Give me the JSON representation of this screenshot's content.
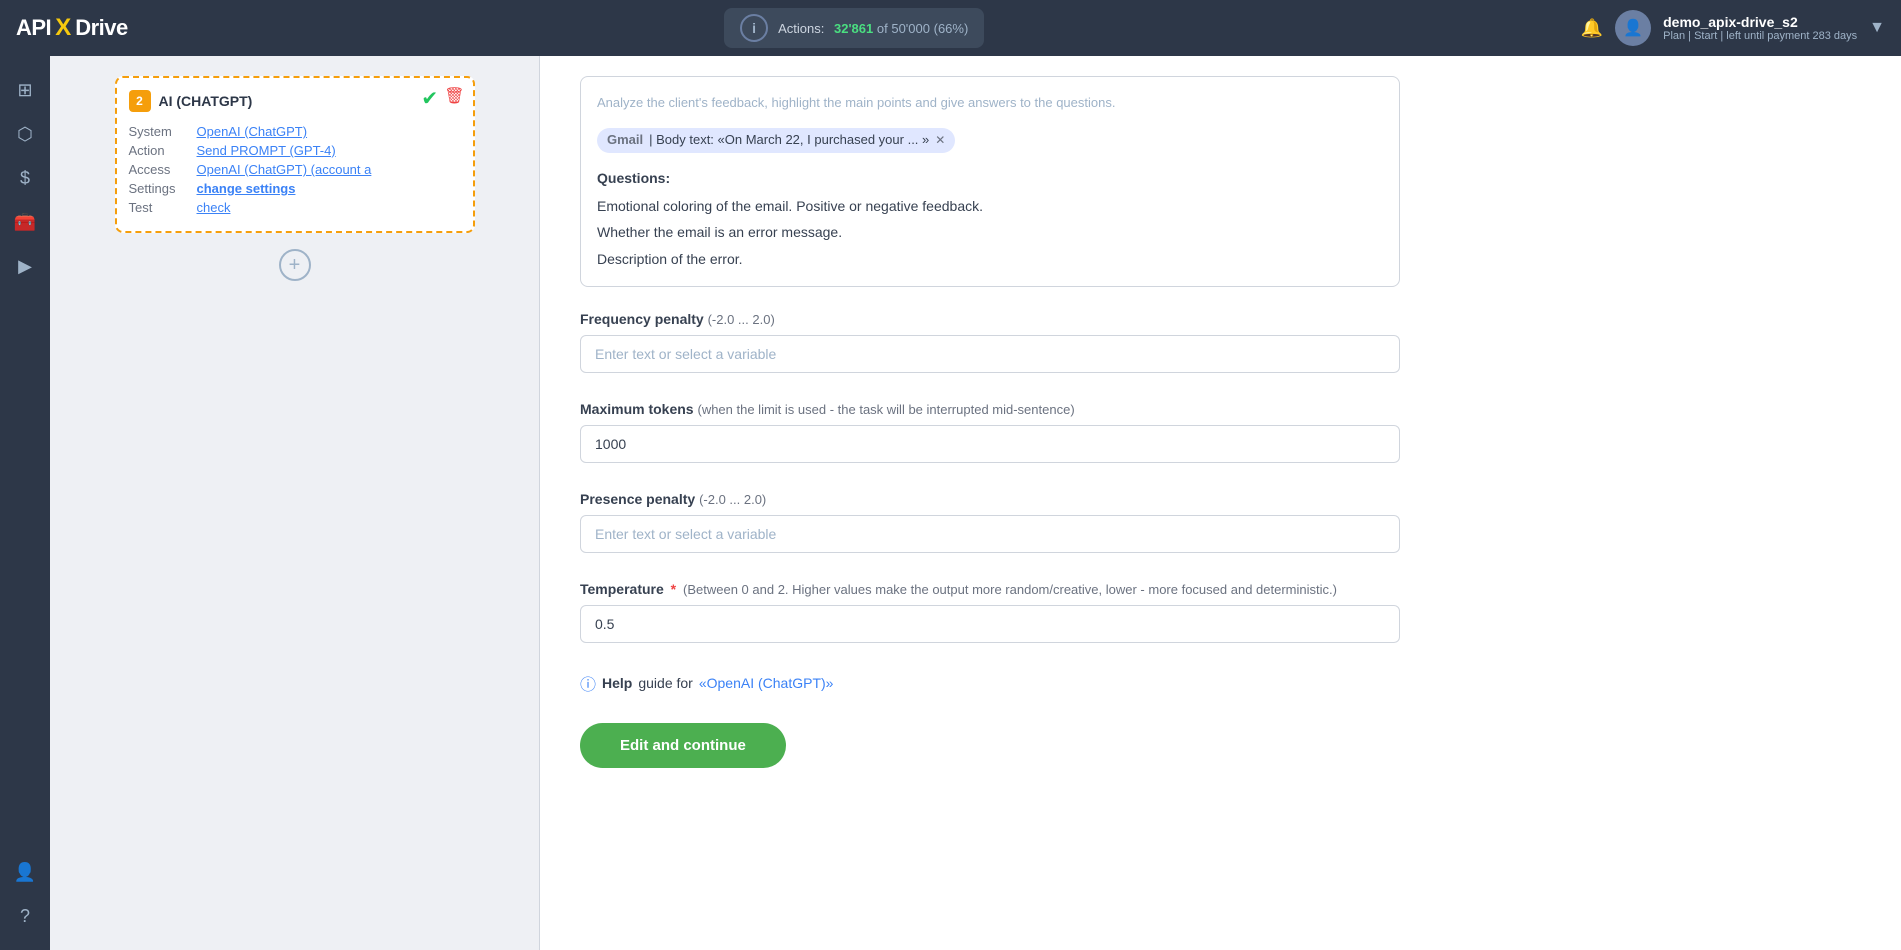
{
  "topnav": {
    "logo": "APIXDrive",
    "logo_x": "X",
    "actions_label": "Actions:",
    "actions_count": "32'861",
    "actions_of": "of",
    "actions_total": "50'000",
    "actions_pct": "(66%)",
    "bell_icon": "🔔",
    "avatar_icon": "👤",
    "user_name": "demo_apix-drive_s2",
    "user_plan": "Plan | Start | left until payment 283 days",
    "chevron": "▼"
  },
  "sidebar": {
    "items": [
      {
        "icon": "⊞",
        "name": "dashboard"
      },
      {
        "icon": "⬡",
        "name": "connections"
      },
      {
        "icon": "$",
        "name": "billing"
      },
      {
        "icon": "🧰",
        "name": "tools"
      },
      {
        "icon": "▶",
        "name": "runs"
      },
      {
        "icon": "👤",
        "name": "profile"
      },
      {
        "icon": "?",
        "name": "help"
      }
    ]
  },
  "ai_card": {
    "badge": "2",
    "title": "AI (CHATGPT)",
    "rows": [
      {
        "label": "System",
        "value": "OpenAI (ChatGPT)",
        "type": "link"
      },
      {
        "label": "Action",
        "value": "Send PROMPT (GPT-4)",
        "type": "link"
      },
      {
        "label": "Access",
        "value": "OpenAI (ChatGPT) (account a",
        "type": "link"
      },
      {
        "label": "Settings",
        "value": "change settings",
        "type": "bold-link"
      },
      {
        "label": "Test",
        "value": "check",
        "type": "link"
      }
    ]
  },
  "prompt_box": {
    "intro": "Analyze the client's feedback, highlight the main points and give answers to the questions.",
    "tag_source": "Gmail",
    "tag_text": "| Body text: «On March 22, I purchased your ... »",
    "questions_label": "Questions:",
    "question1": "Emotional coloring of the email.  Positive or negative feedback.",
    "question2": "Whether the email is an error message.",
    "question3": "Description of the error."
  },
  "form": {
    "frequency_label": "Frequency penalty",
    "frequency_note": "(-2.0 ... 2.0)",
    "frequency_placeholder": "Enter text or select a variable",
    "frequency_value": "",
    "max_tokens_label": "Maximum tokens",
    "max_tokens_note": "(when the limit is used - the task will be interrupted mid-sentence)",
    "max_tokens_value": "1000",
    "presence_label": "Presence penalty",
    "presence_note": "(-2.0 ... 2.0)",
    "presence_placeholder": "Enter text or select a variable",
    "presence_value": "",
    "temperature_label": "Temperature",
    "temperature_required": "*",
    "temperature_note": "(Between 0 and 2. Higher values make the output more random/creative, lower - more focused and deterministic.)",
    "temperature_value": "0.5",
    "help_text": "Help",
    "help_guide": "guide for",
    "help_link": "«OpenAI (ChatGPT)»",
    "edit_btn": "Edit and continue"
  }
}
